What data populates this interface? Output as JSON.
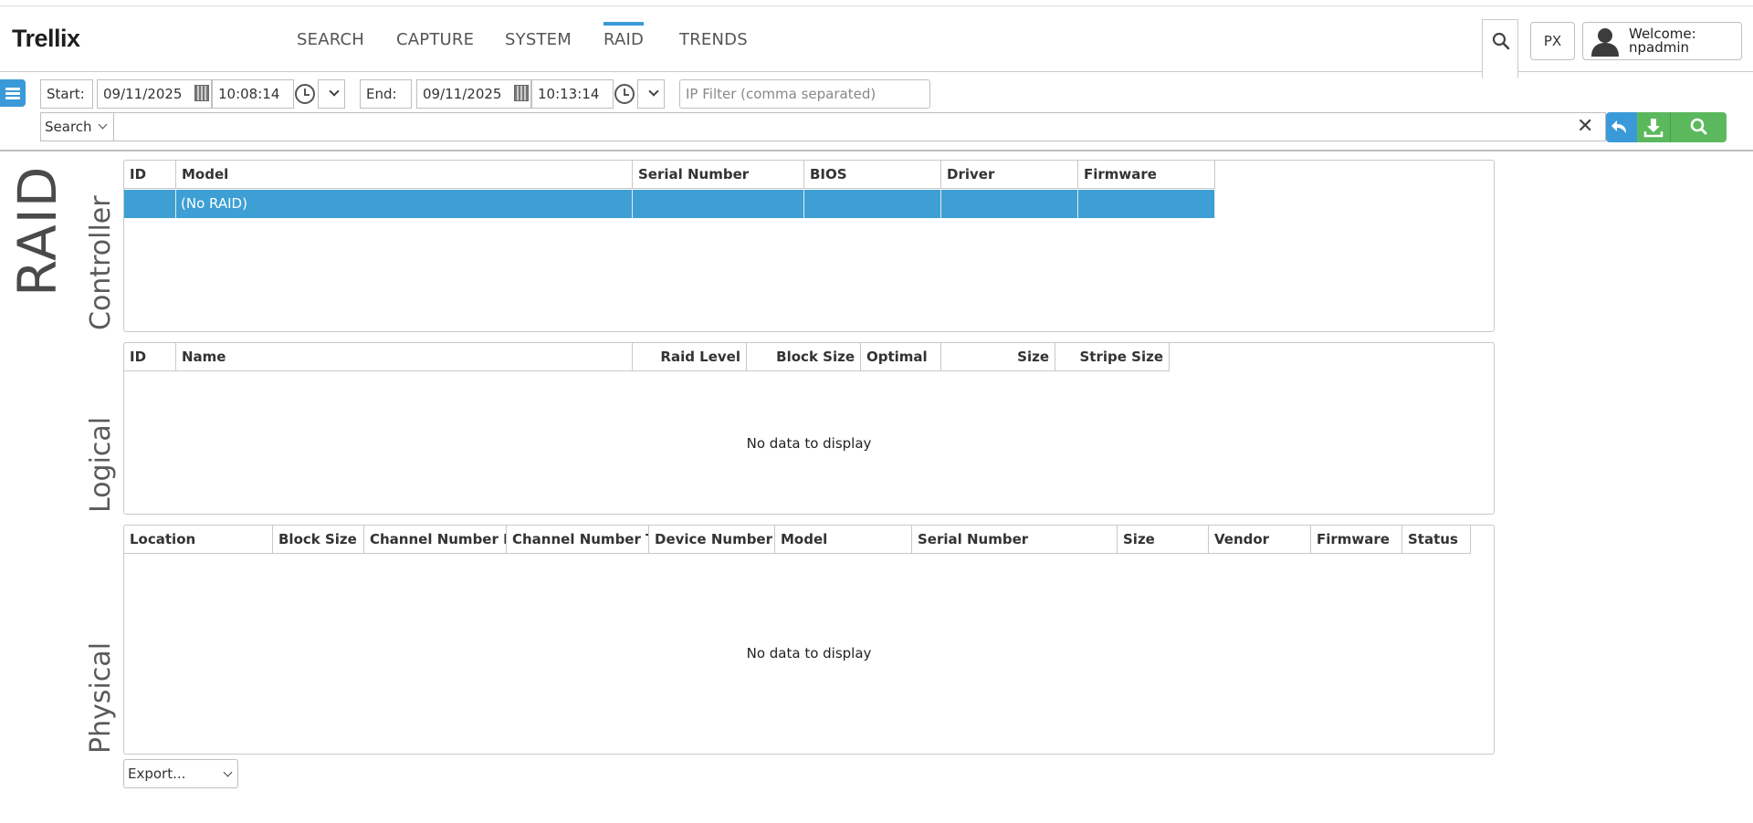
{
  "brand": {
    "name": "Trellix"
  },
  "nav": {
    "items": [
      {
        "label": "SEARCH"
      },
      {
        "label": "CAPTURE"
      },
      {
        "label": "SYSTEM"
      },
      {
        "label": "RAID"
      },
      {
        "label": "TRENDS"
      }
    ],
    "active": "RAID"
  },
  "header": {
    "px_label": "PX",
    "welcome_label": "Welcome:",
    "username": "npadmin"
  },
  "filters": {
    "start_label": "Start:",
    "start_date": "09/11/2025",
    "start_time": "10:08:14",
    "end_label": "End:",
    "end_date": "09/11/2025",
    "end_time": "10:13:14",
    "ip_placeholder": "IP Filter (comma separated)"
  },
  "search": {
    "mode": "Search",
    "query": ""
  },
  "page": {
    "title": "RAID"
  },
  "controller": {
    "section_title": "Controller",
    "columns": [
      "ID",
      "Model",
      "Serial Number",
      "BIOS",
      "Driver",
      "Firmware"
    ],
    "rows": [
      {
        "id": "",
        "model": "(No RAID)",
        "serial": "",
        "bios": "",
        "driver": "",
        "firmware": ""
      }
    ]
  },
  "logical": {
    "section_title": "Logical",
    "columns": [
      "ID",
      "Name",
      "Raid Level",
      "Block Size",
      "Optimal",
      "Size",
      "Stripe Size"
    ],
    "empty_text": "No data to display"
  },
  "physical": {
    "section_title": "Physical",
    "columns": [
      "Location",
      "Block Size",
      "Channel Number L",
      "Channel Number T",
      "Device Number",
      "Model",
      "Serial Number",
      "Size",
      "Vendor",
      "Firmware",
      "Status"
    ],
    "empty_text": "No data to display"
  },
  "export": {
    "label": "Export..."
  },
  "colors": {
    "accent": "#3a9ad9",
    "selected_row": "#3d9fd4",
    "go_green": "#5bb85d"
  },
  "icons": [
    "search-icon",
    "user-icon",
    "menu-icon",
    "calendar-icon",
    "clock-icon",
    "chevron-down-icon",
    "close-icon",
    "undo-icon",
    "download-icon"
  ]
}
